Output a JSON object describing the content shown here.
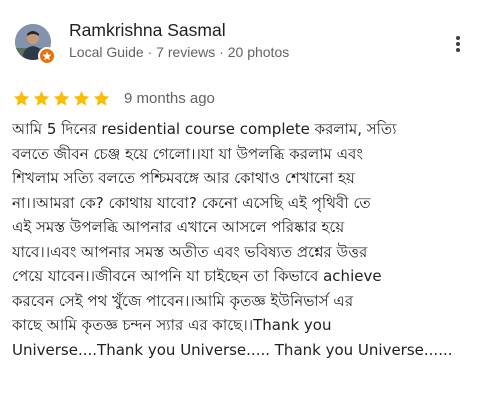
{
  "reviewer": {
    "name": "Ramkrishna Sasmal",
    "meta": "Local Guide · 7 reviews · 20 photos",
    "avatar_icon": "user-avatar",
    "badge_icon": "local-guide-badge-icon",
    "badge_color": "#e8710a"
  },
  "menu": {
    "icon": "more-vert-icon"
  },
  "review": {
    "rating": 5,
    "max_rating": 5,
    "star_color": "#fbbc04",
    "date": "9 months ago",
    "lines": [
      "আমি 5 দিনের residential course complete করলাম, সত্যি",
      "বলতে জীবন চেঞ্জ হয়ে গেলো।।যা যা উপলব্ধি করলাম এবং",
      "শিখলাম সত্যি বলতে পশ্চিমবঙ্গে আর কোথাও শেখানো হয়",
      "না।।আমরা কে? কোথায় যাবো? কেনো এসেছি এই পৃথিবী তে",
      "এই সমস্ত উপলব্ধি আপনার এখানে আসলে পরিষ্কার হয়ে",
      "যাবে।।এবং আপনার সমস্ত অতীত এবং ভবিষ্যত প্রশ্নের উত্তর",
      "পেয়ে যাবেন।।জীবনে আপনি যা চাইছেন তা কিভাবে achieve",
      "করবেন সেই পথ খুঁজে পাবেন।।আমি কৃতজ্ঞ ইউনিভার্স এর",
      "কাছে আমি কৃতজ্ঞ চন্দন স্যার এর কাছে।।Thank you",
      "Universe....Thank you Universe..... Thank you Universe......"
    ]
  }
}
